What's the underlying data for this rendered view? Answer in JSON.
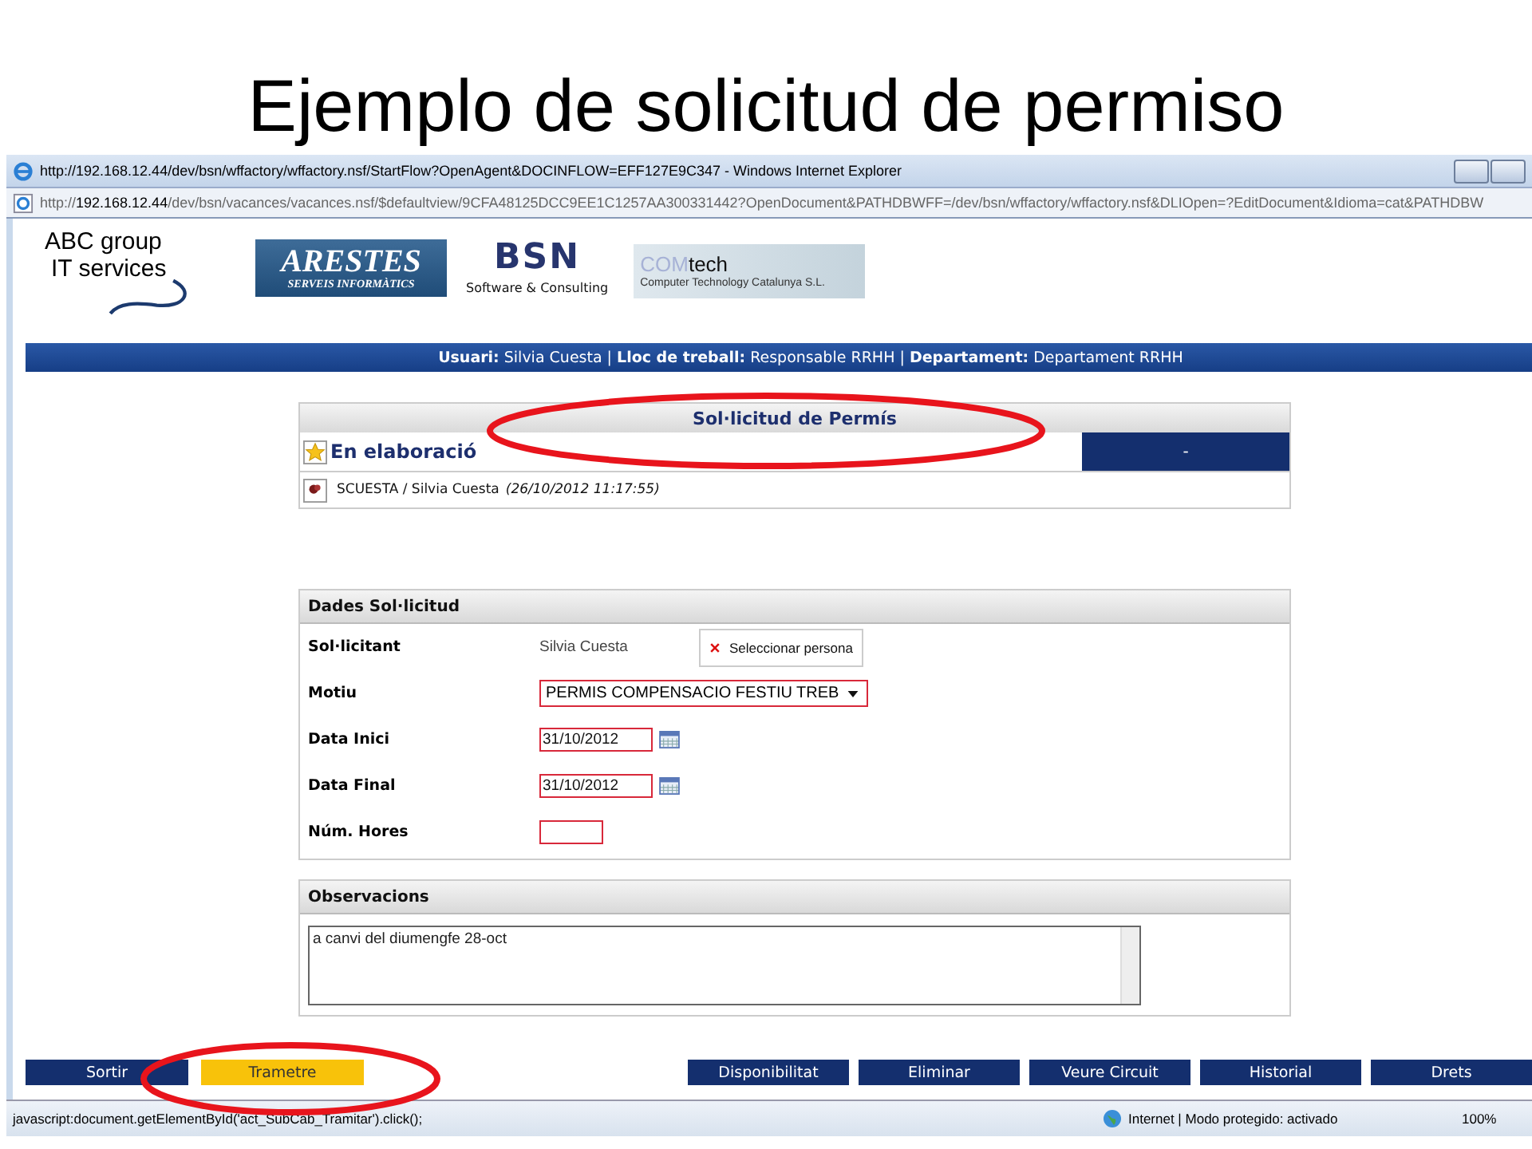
{
  "slide": {
    "title": "Ejemplo de solicitud de permiso"
  },
  "window": {
    "title": "http://192.168.12.44/dev/bsn/wffactory/wffactory.nsf/StartFlow?OpenAgent&DOCINFLOW=EFF127E9C347 - Windows Internet Explorer",
    "address": "http://**192.168.12.44**/dev/bsn/vacances/vacances.nsf/$defaultview/9CFA48125DCC9EE1C1257AA300331442?OpenDocument&PATHDBWFF=/dev/bsn/wffactory/wffactory.nsf&DLIOpen=?EditDocument&Idioma=cat&PATHDBW"
  },
  "logos": {
    "abc": [
      "ABC  group",
      "IT services"
    ],
    "arestes": [
      "ARESTES",
      "SERVEIS INFORMÀTICS"
    ],
    "bsn": [
      "BSN",
      "Software & Consulting"
    ],
    "comtech": [
      "COM",
      "tech",
      "Computer Technology Catalunya S.L."
    ]
  },
  "user_bar": "**Usuari:** Silvia Cuesta | **Lloc de treball:** Responsable RRHH | **Departament:** Departament RRHH",
  "document": {
    "title": "Sol·licitud de Permís",
    "status": "En elaboració",
    "status_code": "-",
    "author": "SCUESTA / Silvia Cuesta",
    "timestamp": "(26/10/2012 11:17:55)"
  },
  "form": {
    "title": "Dades Sol·licitud",
    "fields": [
      {
        "kind": "text",
        "label": "Sol·licitant",
        "value": "Silvia Cuesta",
        "button": "Seleccionar persona"
      },
      {
        "kind": "select",
        "label": "Motiu",
        "value": "PERMIS COMPENSACIO FESTIU TREB",
        "required": true
      },
      {
        "kind": "date",
        "label": "Data Inici",
        "value": "31/10/2012",
        "required": true
      },
      {
        "kind": "date",
        "label": "Data Final",
        "value": "31/10/2012",
        "required": true
      },
      {
        "kind": "input",
        "label": "Núm. Hores",
        "required": true
      }
    ]
  },
  "observations": {
    "title": "Observacions",
    "value": "a canvi del diumengfe 28-oct"
  },
  "actions": [
    {
      "label": "Sortir",
      "hovered": false
    },
    {
      "label": "Trametre",
      "hovered": true
    },
    {
      "label": "Disponibilitat",
      "hovered": false
    },
    {
      "label": "Eliminar",
      "hovered": false
    },
    {
      "label": "Veure Circuit",
      "hovered": false
    },
    {
      "label": "Historial",
      "hovered": false
    },
    {
      "label": "Drets",
      "hovered": false
    }
  ],
  "status_bar": {
    "text": "javascript:document.getElementById('act_SubCab_Tramitar').click();",
    "zone": "Internet | Modo protegido: activado",
    "zoom": "100%"
  }
}
